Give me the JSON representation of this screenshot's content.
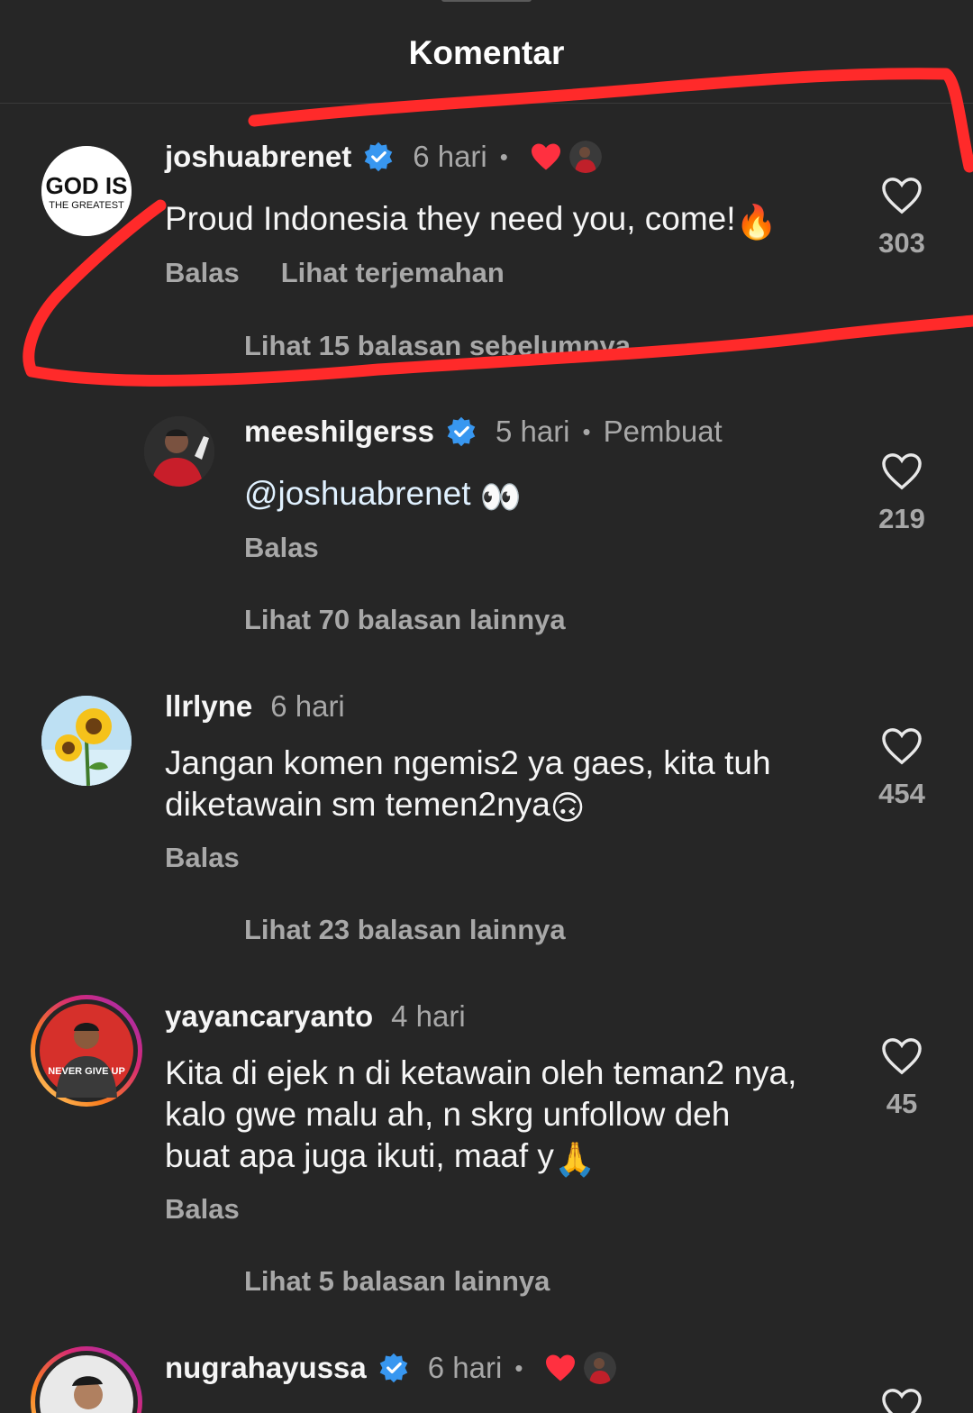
{
  "header": {
    "title": "Komentar"
  },
  "colors": {
    "background": "#262626",
    "like_red": "#ff3040",
    "verified_blue": "#3897f0",
    "annotation_red": "#ff2a2a"
  },
  "comments": [
    {
      "username": "joshuabrenet",
      "verified": true,
      "time": "6 hari",
      "liked_by_creator": true,
      "text": "Proud Indonesia they need you, come!",
      "text_emoji": "🔥",
      "actions": [
        "Balas",
        "Lihat terjemahan"
      ],
      "likes": "303",
      "view_replies": "Lihat 15 balasan sebelumnya",
      "avatar_text_1": "GOD IS",
      "avatar_text_2": "THE GREATEST"
    },
    {
      "username": "meeshilgerss",
      "verified": true,
      "time": "5 hari",
      "creator_label": "Pembuat",
      "mention": "@joshuabrenet",
      "text_emoji": "👀",
      "actions": [
        "Balas"
      ],
      "likes": "219",
      "view_replies": "Lihat 70 balasan lainnya"
    },
    {
      "username": "llrlyne",
      "verified": false,
      "time": "6 hari",
      "text_line1": "Jangan komen ngemis2 ya gaes, kita tuh",
      "text_line2": "diketawain sm temen2nya",
      "text_emoji": "🙃",
      "actions": [
        "Balas"
      ],
      "likes": "454",
      "view_replies": "Lihat 23 balasan lainnya"
    },
    {
      "username": "yayancaryanto",
      "verified": false,
      "time": "4 hari",
      "text_line1": "Kita di ejek n di ketawain oleh teman2 nya,",
      "text_line2": "kalo gwe malu ah, n skrg unfollow deh",
      "text_line3": "buat apa juga ikuti, maaf y",
      "text_emoji": "🙏",
      "actions": [
        "Balas"
      ],
      "likes": "45",
      "view_replies": "Lihat 5 balasan lainnya",
      "avatar_text": "NEVER GIVE UP"
    },
    {
      "username": "nugrahayussa",
      "verified": true,
      "time": "6 hari",
      "liked_by_creator": true
    }
  ]
}
